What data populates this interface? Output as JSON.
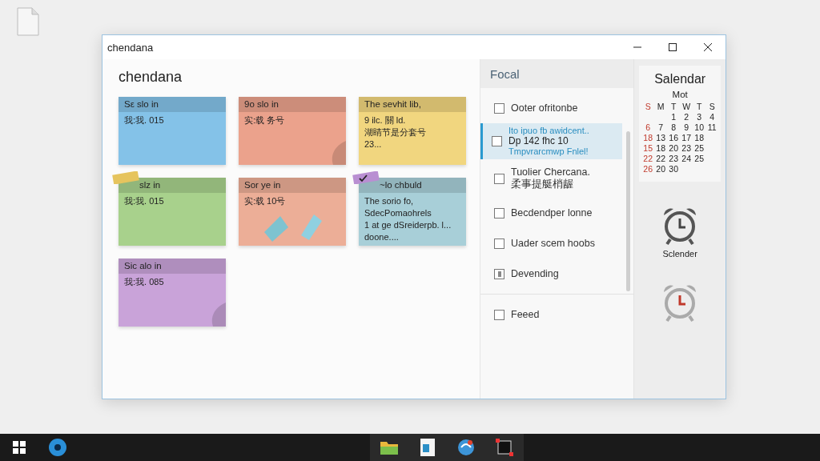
{
  "window": {
    "title": "chendana"
  },
  "notes_panel": {
    "heading": "chendana"
  },
  "notes": [
    {
      "color": "#84c2e8",
      "title": "Sε slo in",
      "lines": [
        "我:我. 015"
      ],
      "kind": "plain"
    },
    {
      "color": "#eba28c",
      "title": "9o slo in",
      "lines": [
        "实:载 务号"
      ],
      "kind": "curl"
    },
    {
      "color": "#f1d67f",
      "title": "The sevhit lib,",
      "lines": [
        "9 ilc. 關 ld.",
        "湖睛节是分套号",
        "23..."
      ],
      "kind": "plain"
    },
    {
      "color": "#a8d18c",
      "title": "slz in",
      "lines": [
        "我:我. 015"
      ],
      "kind": "tape"
    },
    {
      "color": "#ecae97",
      "title": "Sor ye in",
      "lines": [
        "实:载 10号"
      ],
      "kind": "pieces"
    },
    {
      "color": "#a8cfd8",
      "title": "~lo chbuld",
      "lines": [
        "The sorio fo,",
        "SdecPomaohrels",
        "1 at ge dSreiderpb. l...",
        "doone...."
      ],
      "kind": "check-tape"
    },
    {
      "color": "#c9a3d9",
      "title": "Sic alo in",
      "lines": [
        "我:我. 085"
      ],
      "kind": "curl"
    }
  ],
  "focal": {
    "title": "Focal",
    "sections": [
      {
        "items": [
          {
            "lines": [
              "Ooter ofritonbe"
            ],
            "indeterminate": false,
            "selected": false
          },
          {
            "lines": [
              "Ito ipuo fb awidcent..",
              "Dp 142 fhc 10",
              "Tmpvrarcmwp Fnlel!"
            ],
            "indeterminate": false,
            "selected": true
          },
          {
            "lines": [
              "Tuolier Chercana.",
              "柔事提艇梢龌"
            ],
            "indeterminate": false,
            "selected": false
          },
          {
            "lines": [
              "Becdendper lonne"
            ],
            "indeterminate": false,
            "selected": false
          },
          {
            "lines": [
              "Uader scem hoobs"
            ],
            "indeterminate": false,
            "selected": false
          },
          {
            "lines": [
              "Devending"
            ],
            "indeterminate": true,
            "selected": false
          }
        ]
      },
      {
        "items": [
          {
            "lines": [
              "Feeed"
            ],
            "indeterminate": false,
            "selected": false
          }
        ]
      }
    ]
  },
  "calendar": {
    "title": "Salendar",
    "month": "Mot",
    "weekdays": [
      "S",
      "M",
      "T",
      "W",
      "T",
      "S"
    ],
    "weeks": [
      [
        "1",
        "2",
        "3",
        "4"
      ],
      [
        "6",
        "7",
        "8",
        "9",
        "10",
        "11"
      ],
      [
        "18",
        "13",
        "16",
        "17",
        "18"
      ],
      [
        "15",
        "18",
        "20",
        "23",
        "25"
      ],
      [
        "22",
        "22",
        "23",
        "24",
        "25"
      ],
      [
        "26",
        "20",
        "30"
      ]
    ]
  },
  "alarms": [
    {
      "label": "Sclender",
      "active": true
    },
    {
      "active": false
    }
  ]
}
